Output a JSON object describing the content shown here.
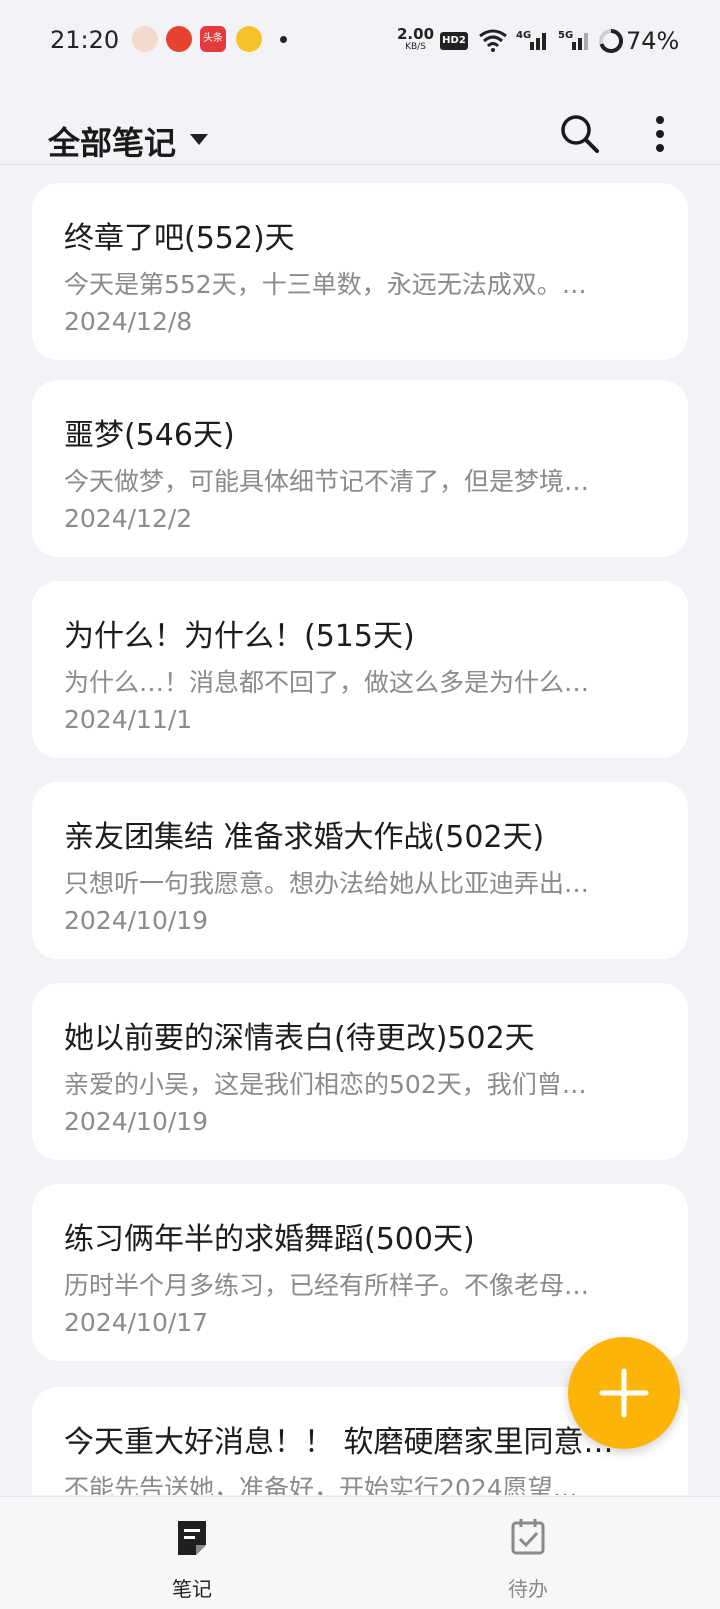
{
  "status_bar": {
    "time": "21:20",
    "notif_badge": "头条",
    "net_speed": "2.00",
    "net_speed_unit": "KB/S",
    "hd_badge": "HD2",
    "signal1_label": "4G",
    "signal2_label": "5G",
    "battery": "74%"
  },
  "header": {
    "title": "全部笔记",
    "search_icon": "search-icon",
    "more_icon": "more-vert-icon"
  },
  "notes": [
    {
      "title": "终章了吧(552)天",
      "preview": "今天是第552天，十三单数，永远无法成双。…",
      "date": "2024/12/8"
    },
    {
      "title": "噩梦(546天)",
      "preview": "今天做梦，可能具体细节记不清了，但是梦境…",
      "date": "2024/12/2"
    },
    {
      "title": "为什么！为什么！(515天)",
      "preview": "为什么…！消息都不回了，做这么多是为什么…",
      "date": "2024/11/1"
    },
    {
      "title": "亲友团集结 准备求婚大作战(502天)",
      "preview": "只想听一句我愿意。想办法给她从比亚迪弄出…",
      "date": "2024/10/19"
    },
    {
      "title": "她以前要的深情表白(待更改)502天",
      "preview": "亲爱的小吴，这是我们相恋的502天，我们曾…",
      "date": "2024/10/19"
    },
    {
      "title": "练习俩年半的求婚舞蹈(500天)",
      "preview": "历时半个月多练习，已经有所样子。不像老母…",
      "date": "2024/10/17"
    },
    {
      "title": "今天重大好消息！！ 软磨硬磨家里同意…",
      "preview": "不能先告送她，准备好，开始实行2024愿望…",
      "date": ""
    }
  ],
  "fab": {
    "icon": "add-icon"
  },
  "bottom_nav": {
    "notes_label": "笔记",
    "todo_label": "待办",
    "active": "notes"
  },
  "colors": {
    "accent": "#fdb408",
    "background": "#f2f3f6",
    "card": "#ffffff",
    "secondary_text": "#8b8b8b"
  }
}
